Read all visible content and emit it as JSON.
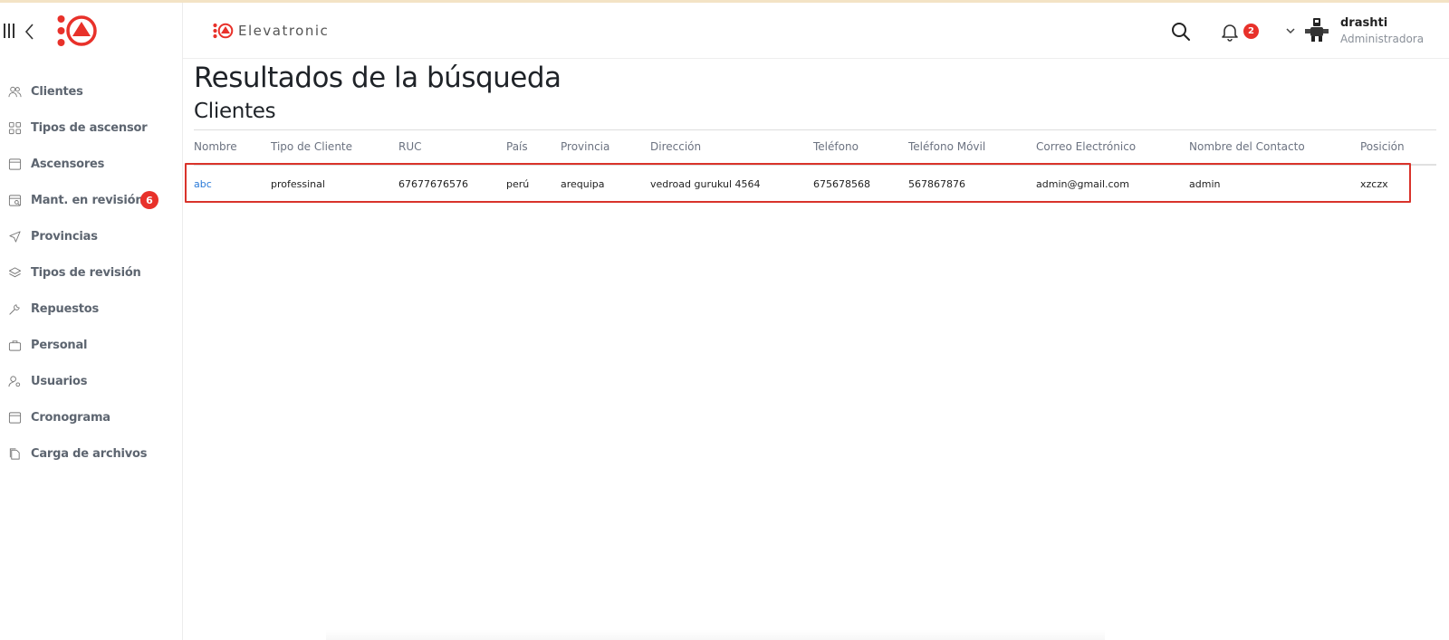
{
  "app": {
    "brand_name": "Elevatronic",
    "accent_color": "#e8312a"
  },
  "sidebar": {
    "items": [
      {
        "label": "Clientes",
        "icon": "users-icon"
      },
      {
        "label": "Tipos de ascensor",
        "icon": "grid-icon"
      },
      {
        "label": "Ascensores",
        "icon": "window-icon"
      },
      {
        "label": "Mant. en revisión",
        "icon": "calendar-search-icon",
        "badge": "6"
      },
      {
        "label": "Provincias",
        "icon": "send-icon"
      },
      {
        "label": "Tipos de revisión",
        "icon": "layers-icon"
      },
      {
        "label": "Repuestos",
        "icon": "wrench-icon"
      },
      {
        "label": "Personal",
        "icon": "briefcase-icon"
      },
      {
        "label": "Usuarios",
        "icon": "user-settings-icon"
      },
      {
        "label": "Cronograma",
        "icon": "calendar-icon"
      },
      {
        "label": "Carga de archivos",
        "icon": "files-icon"
      }
    ]
  },
  "header": {
    "notifications_count": "2",
    "user": {
      "name": "drashti",
      "role": "Administradora"
    }
  },
  "main": {
    "title": "Resultados de la búsqueda",
    "section_title": "Clientes",
    "table": {
      "columns": [
        "Nombre",
        "Tipo de Cliente",
        "RUC",
        "País",
        "Provincia",
        "Dirección",
        "Teléfono",
        "Teléfono Móvil",
        "Correo Electrónico",
        "Nombre del Contacto",
        "Posición"
      ],
      "rows": [
        [
          "abc",
          "professinal",
          "67677676576",
          "perú",
          "arequipa",
          "vedroad gurukul 4564",
          "675678568",
          "567867876",
          "admin@gmail.com",
          "admin",
          "xzczx"
        ]
      ]
    }
  }
}
